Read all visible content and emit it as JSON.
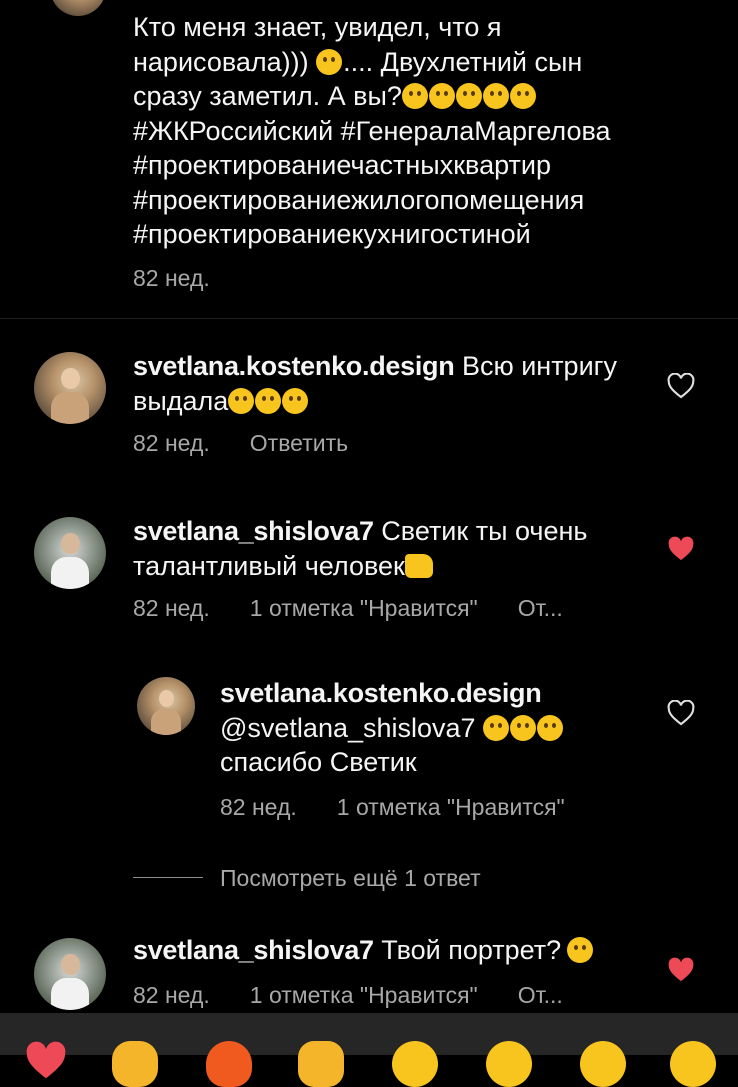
{
  "caption": {
    "lines": [
      "Кто меня знает, увидел, что я",
      "нарисовала))) ",
      ".... Двухлетний сын",
      "сразу заметил. А вы?",
      "#ЖКРоссийский #ГенералаМаргелова",
      "#проектированиечастныхквартир",
      "#проектированиежилогопомещения",
      "#проектированиекухнигостиной"
    ],
    "time": "82 нед."
  },
  "comments": [
    {
      "username": "svetlana.kostenko.design",
      "text_line1": "Всю интригу",
      "text_line2": "выдала",
      "time": "82 нед.",
      "reply_label": "Ответить",
      "liked": false
    },
    {
      "username": "svetlana_shislova7",
      "text_line1": "Светик ты очень",
      "text_line2": "талантливый человек",
      "time": "82 нед.",
      "likes": "1 отметка \"Нравится\"",
      "reply_label": "От...",
      "liked": true
    },
    {
      "username": "svetlana.kostenko.design",
      "mention": "@svetlana_shislova7",
      "text_line2": "спасибо Светик",
      "time": "82 нед.",
      "likes": "1 отметка \"Нравится\"",
      "liked": false
    },
    {
      "username": "svetlana_shislova7",
      "text_line1": "Твой портрет?",
      "time": "82 нед.",
      "likes": "1 отметка \"Нравится\"",
      "reply_label": "От...",
      "liked": true
    }
  ],
  "view_more_replies": "Посмотреть ещё 1 ответ",
  "icons": {
    "heart_outline": "heart-outline-icon",
    "heart_filled": "heart-filled-icon"
  },
  "colors": {
    "background": "#000000",
    "text": "#f5f5f5",
    "meta": "#a8a8a8",
    "heart_red": "#ed4956",
    "bottom_bar": "#262626"
  }
}
